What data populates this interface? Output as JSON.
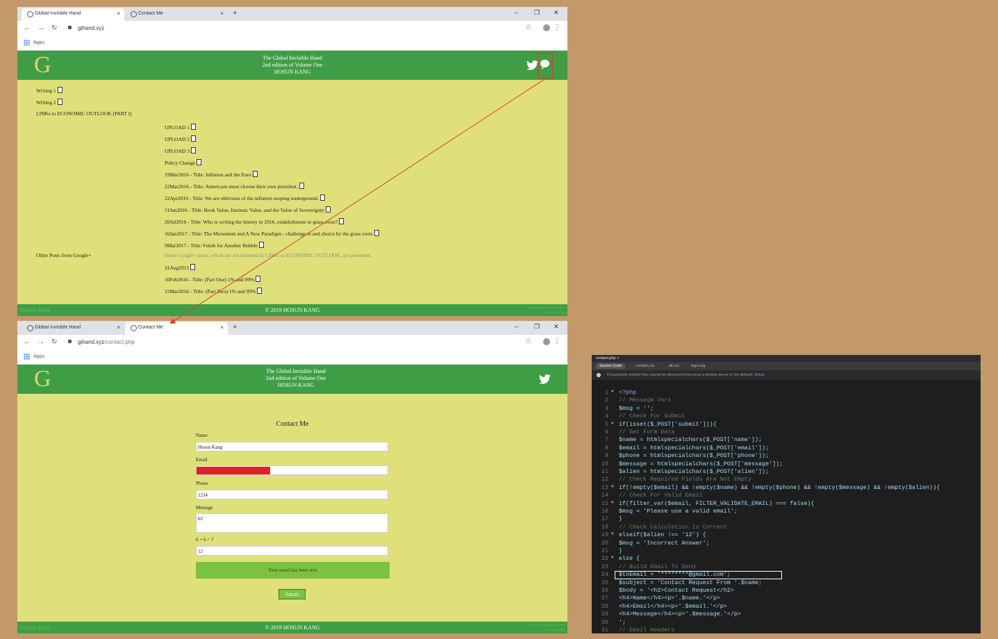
{
  "tab1_title": "Global Invisible Hand",
  "tab2_title": "Contact Me",
  "tab_close": "×",
  "new_tab": "+",
  "window_controls": [
    "–",
    "❐",
    "✕"
  ],
  "url1": "gihand.xyz",
  "url2_host": "gihand.xyz",
  "url2_path": "/contact.php",
  "bookmarks_apps": "Apps",
  "site": {
    "logo": "G",
    "title_lines": [
      "The Global Invisible Hand",
      "2nd edition of Volume One",
      "HOSUN KANG"
    ],
    "footer": "© 2019 HOSUN KANG",
    "footer_left": "Yushim Kang",
    "footer_right": [
      "Soft to practice Industry 2. AHT",
      "Then will use then"
    ]
  },
  "home": {
    "top_links": [
      "Writing 1",
      "Writing 2"
    ],
    "section_links_header": "LINKs to ECONOMIC OUTLOOK (PART I)",
    "section_items": [
      "UPLOAD 1",
      "UPLOAD 2",
      "UPLOAD 3",
      "Policy Change",
      "19Mar2016 - Title: Inflation and the Euro",
      "22Mar2016 - Title: Americans must choose their own president.",
      "22Apr2016 - Title: We are oblivious of the inflation seeping underground.",
      "11Jun2016 - Title: Book Value, Intrinsic Value, and the Value of Sovereignty",
      "20Jul2016 - Title: Who is writing the history in 2016, establishment or grass roots?",
      "16Jan2017 - Title: The Movement and A New Paradigm - challenge to and choice by the grass roots",
      "9Mar2017 - Title: Fetish for Another Bubble"
    ],
    "other_header": "Other Posts from Google+",
    "other_note": "Some Google+ posts, which are not included in LINKs to ECONOMIC OUTLOOK, are presented.",
    "other_items": [
      "31Aug2015",
      "10Feb2016 - Title: (Part One) 1% and 99%",
      "15Mar2016 - Title: (Part Two) 1% and 99%"
    ]
  },
  "contact": {
    "title": "Contact Me",
    "name_label": "Name",
    "name_value": "Hosun Kang",
    "email_label": "Email",
    "phone_label": "Phone",
    "phone_value": "1234",
    "message_label": "Message",
    "message_value": "hi!",
    "captcha_label": "6 + 6 = ?",
    "captcha_value": "12",
    "sent_message": "Your email has been sent",
    "submit": "Submit"
  },
  "editor": {
    "file_tab": "contact.php  ×",
    "tabs": [
      "Source Code",
      "contact.css",
      "all.css",
      "logo.svg"
    ],
    "info_icon": "i",
    "info": "Dynamically-related files cannot be discovered because a testing server is not defined.",
    "info_link": "Setup",
    "lines": [
      {
        "n": "1",
        "t": "<?php",
        "c": "kw",
        "a": "▼"
      },
      {
        "n": "2",
        "t": "// Message Vars",
        "c": "cm"
      },
      {
        "n": "3",
        "t": "$msg = '';",
        "c": ""
      },
      {
        "n": "4",
        "t": "// Check For Submit",
        "c": "cm"
      },
      {
        "n": "5",
        "t": "if(isset($_POST['submit'])){",
        "c": "",
        "a": "▼"
      },
      {
        "n": "6",
        "t": "// Get Form Data",
        "c": "cm"
      },
      {
        "n": "7",
        "t": "$name = htmlspecialchars($_POST['name']);",
        "c": ""
      },
      {
        "n": "8",
        "t": "$email = htmlspecialchars($_POST['email']);",
        "c": ""
      },
      {
        "n": "9",
        "t": "$phone = htmlspecialchars($_POST['phone']);",
        "c": ""
      },
      {
        "n": "10",
        "t": "$message = htmlspecialchars($_POST['message']);",
        "c": ""
      },
      {
        "n": "11",
        "t": "$alien = htmlspecialchars($_POST['alien']);",
        "c": ""
      },
      {
        "n": "12",
        "t": "// Check Required Fields Are Not Empty",
        "c": "cm"
      },
      {
        "n": "13",
        "t": "if(!empty($email) && !empty($name) && !empty($phone) && !empty($message) && !empty($alien)){",
        "c": "",
        "a": "▼"
      },
      {
        "n": "14",
        "t": "// Check For Valid Email",
        "c": "cm"
      },
      {
        "n": "15",
        "t": "if(filter_var($email, FILTER_VALIDATE_EMAIL) === false){",
        "c": "",
        "a": "▼"
      },
      {
        "n": "16",
        "t": "$msg = 'Please use a valid email';",
        "c": ""
      },
      {
        "n": "17",
        "t": "}",
        "c": ""
      },
      {
        "n": "18",
        "t": "// Check Calculation Is Correct",
        "c": "cm"
      },
      {
        "n": "19",
        "t": "elseif($alien !== '12') {",
        "c": "",
        "a": "▼"
      },
      {
        "n": "20",
        "t": "$msg = 'Incorrect Answer';",
        "c": ""
      },
      {
        "n": "21",
        "t": "}",
        "c": ""
      },
      {
        "n": "22",
        "t": "else {",
        "c": "",
        "a": "▼"
      },
      {
        "n": "23",
        "t": "// Build Email To Send",
        "c": "cm"
      },
      {
        "n": "24",
        "t": "$toEmail = '********@gmail.com';",
        "c": ""
      },
      {
        "n": "25",
        "t": "$subject = 'Contact Request From '.$name;",
        "c": ""
      },
      {
        "n": "26",
        "t": "$body = '<h2>Contact Request</h2>",
        "c": ""
      },
      {
        "n": "27",
        "t": "<h4>Name</h4><p>'.$name.'</p>",
        "c": ""
      },
      {
        "n": "28",
        "t": "<h4>Email</h4><p>'.$email.'</p>",
        "c": ""
      },
      {
        "n": "29",
        "t": "<h4>Message</h4><p>'.$message.'</p>",
        "c": ""
      },
      {
        "n": "30",
        "t": "';",
        "c": ""
      },
      {
        "n": "31",
        "t": "// Email Headers",
        "c": "cm"
      }
    ]
  },
  "colors": {
    "background": "#c4996a",
    "header_green": "#3f9e45",
    "page_yellow": "#dfe07a",
    "button_green": "#7cc242",
    "annotation_red": "#e03a2a",
    "redaction": "#e02020"
  }
}
